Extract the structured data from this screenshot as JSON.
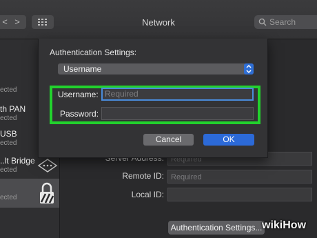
{
  "window": {
    "title": "Network"
  },
  "titlebar": {
    "back_glyph": "<",
    "forward_glyph": ">",
    "grid_icon": "grid-icon",
    "search_placeholder": "Search"
  },
  "sidebar": {
    "items": [
      {
        "status": "ected"
      },
      {
        "name": "th PAN",
        "status": "ected"
      },
      {
        "name": "USB",
        "status": "ected"
      },
      {
        "name": "..lt Bridge",
        "status": "ected",
        "icon": "bridge-icon"
      },
      {
        "status": "ected",
        "icon": "lock-icon",
        "selected": true
      }
    ]
  },
  "main": {
    "server_address": {
      "label": "Server Address:",
      "placeholder": "Required"
    },
    "remote_id": {
      "label": "Remote ID:",
      "placeholder": "Required"
    },
    "local_id": {
      "label": "Local ID:",
      "value": ""
    },
    "auth_settings_button": "Authentication Settings..."
  },
  "sheet": {
    "heading": "Authentication Settings:",
    "method_select": {
      "value": "Username"
    },
    "username": {
      "label": "Username:",
      "placeholder": "Required"
    },
    "password": {
      "label": "Password:",
      "value": ""
    },
    "cancel_label": "Cancel",
    "ok_label": "OK"
  },
  "colors": {
    "highlight": "#22d22d",
    "accent": "#2c6ad8"
  },
  "watermark": {
    "text": "wikiHow"
  }
}
